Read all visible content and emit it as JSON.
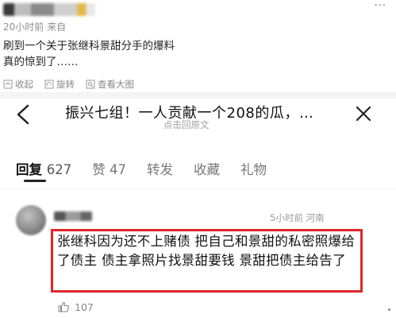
{
  "post": {
    "meta": "20小时前 来自",
    "text_line1": "刷到一个关于张继科景甜分手的爆料",
    "text_line2": "真的惊到了……",
    "more": "···",
    "actions": [
      {
        "label": "收起",
        "icon": "collapse-icon"
      },
      {
        "label": "旋转",
        "icon": "rotate-icon"
      },
      {
        "label": "查看大图",
        "icon": "view-large-icon"
      }
    ]
  },
  "quoted": {
    "title": "振兴七组！一人贡献一个208的瓜，…",
    "subtitle": "点击回原文",
    "tabs": [
      {
        "label": "回复",
        "count": "627",
        "active": true
      },
      {
        "label": "赞",
        "count": "47",
        "active": false
      },
      {
        "label": "转发",
        "count": "",
        "active": false
      },
      {
        "label": "收藏",
        "count": "",
        "active": false
      },
      {
        "label": "礼物",
        "count": "",
        "active": false
      }
    ],
    "comment": {
      "time_loc": "5小时前 河南",
      "text": "张继科因为还不上赌债 把自己和景甜的私密照爆给了债主 债主拿照片找景甜要钱 景甜把债主给告了",
      "likes": "107"
    }
  },
  "colors": {
    "highlight_border": "#e0262b",
    "meta_text": "#8e8e8e"
  }
}
